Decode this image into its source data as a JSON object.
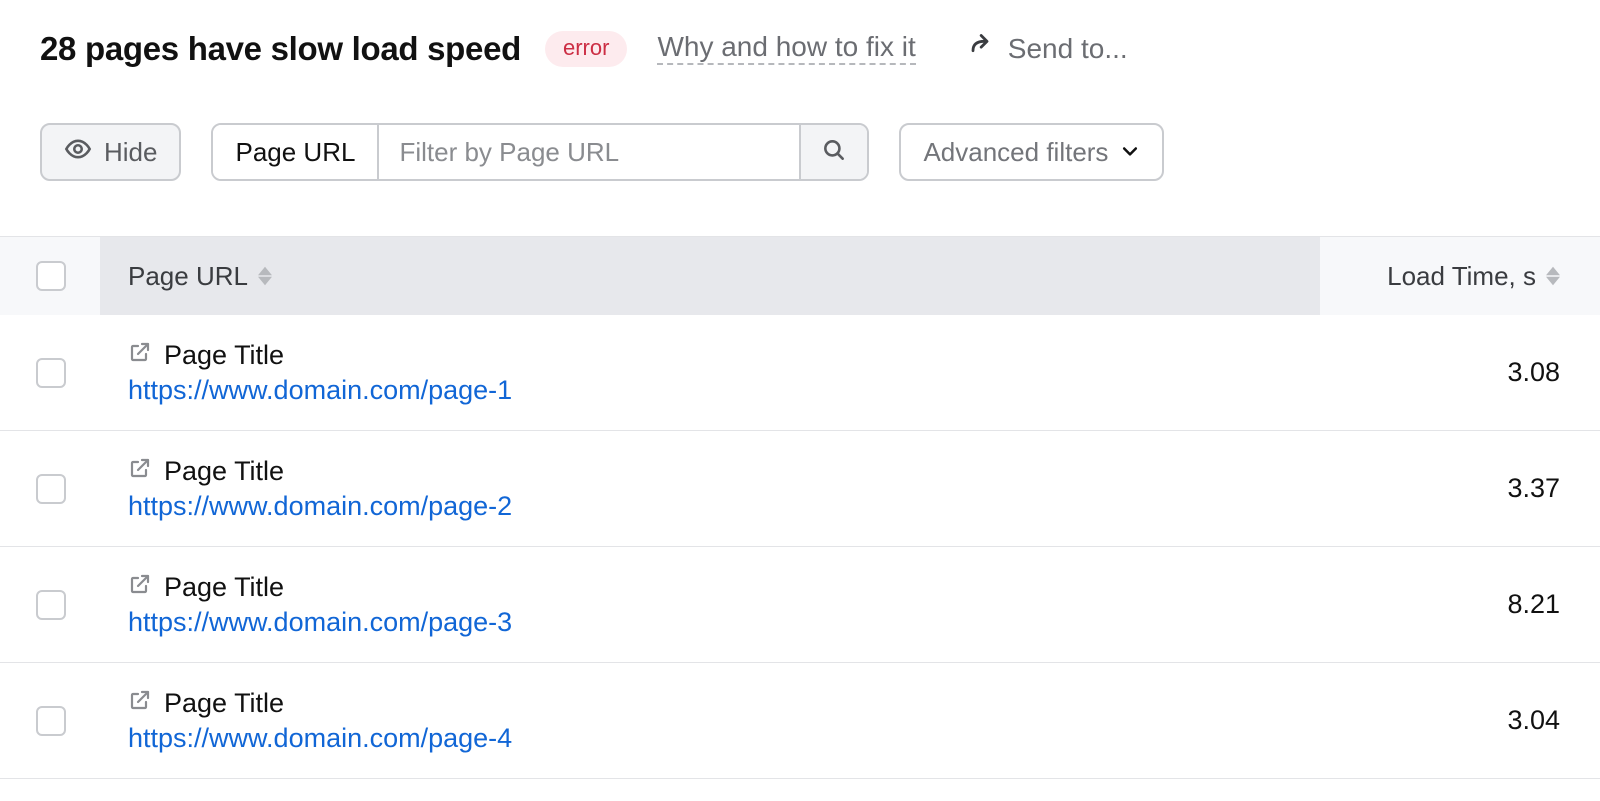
{
  "header": {
    "title": "28 pages have slow load speed",
    "badge": "error",
    "help_link": "Why and how to fix it",
    "send_to": "Send to..."
  },
  "toolbar": {
    "hide_label": "Hide",
    "filter_field_label": "Page URL",
    "filter_placeholder": "Filter by Page URL",
    "advanced_label": "Advanced filters"
  },
  "table": {
    "columns": {
      "url": "Page URL",
      "load": "Load Time, s"
    },
    "rows": [
      {
        "title": "Page Title",
        "url": "https://www.domain.com/page-1",
        "load_time": "3.08"
      },
      {
        "title": "Page Title",
        "url": "https://www.domain.com/page-2",
        "load_time": "3.37"
      },
      {
        "title": "Page Title",
        "url": "https://www.domain.com/page-3",
        "load_time": "8.21"
      },
      {
        "title": "Page Title",
        "url": "https://www.domain.com/page-4",
        "load_time": "3.04"
      }
    ]
  }
}
